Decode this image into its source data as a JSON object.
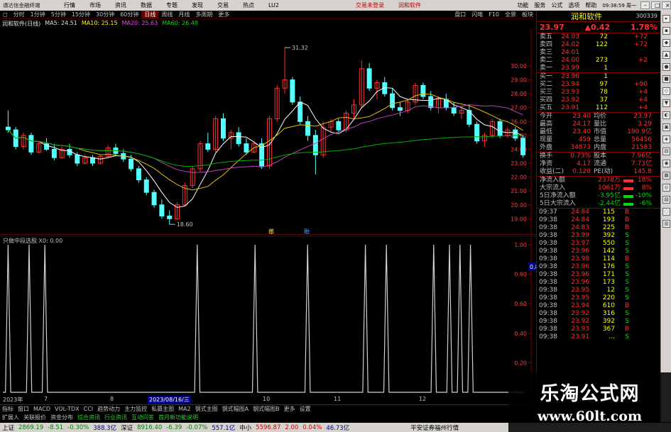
{
  "menubar": {
    "app_title": "通达信金融终端",
    "items": [
      "行情",
      "市场",
      "资讯",
      "数据",
      "专题",
      "发现",
      "交易",
      "热点",
      "LU2"
    ],
    "center_links": [
      "交易未登录",
      "润和软件"
    ],
    "right_items": [
      "功能",
      "服务",
      "公式",
      "选项",
      "帮助"
    ],
    "clock": "09:38:59 周一"
  },
  "period_tabs": {
    "items": [
      "分时",
      "1分钟",
      "5分钟",
      "15分钟",
      "30分钟",
      "60分钟",
      "日线",
      "周线",
      "月线",
      "多周期",
      "更多"
    ],
    "active": "日线"
  },
  "toolbar_right": [
    "盘口",
    "闪电",
    "F10",
    "全景",
    "板块"
  ],
  "ma_line": {
    "stock": "润和软件(日线)",
    "ma5_label": "MA5: 24.51",
    "ma10_label": "MA10: 25.15",
    "ma20_label": "MA20: 25.63",
    "ma60_label": "MA60: 26.48"
  },
  "colors": {
    "up": "#ff3030",
    "down": "#54ffff",
    "ma5": "#ffffff",
    "ma10": "#e0c000",
    "ma20": "#c040c0",
    "ma60": "#00b000",
    "axis": "#800000",
    "signal": "#d0d0d0"
  },
  "chart_data": [
    {
      "type": "candlestick",
      "ylim": [
        18.0,
        32.5
      ],
      "y_ticks": [
        "30.00",
        "29.00",
        "28.00",
        "27.00",
        "26.00",
        "25.00",
        "24.00",
        "23.00",
        "22.00",
        "21.00",
        "20.00",
        "19.00"
      ],
      "annotations": [
        "31.32",
        "18.60"
      ],
      "markers": [
        "撤",
        "融"
      ],
      "ohlc": [
        [
          25.6,
          26.8,
          25.2,
          25.4
        ],
        [
          25.4,
          25.6,
          24.0,
          24.2
        ],
        [
          24.2,
          25.2,
          24.0,
          25.0
        ],
        [
          25.0,
          25.2,
          23.6,
          23.8
        ],
        [
          23.8,
          24.6,
          23.7,
          24.4
        ],
        [
          24.4,
          24.8,
          23.9,
          24.0
        ],
        [
          24.0,
          24.4,
          23.2,
          23.4
        ],
        [
          23.4,
          24.2,
          23.3,
          24.0
        ],
        [
          24.0,
          24.4,
          23.4,
          23.6
        ],
        [
          23.6,
          23.8,
          22.8,
          23.0
        ],
        [
          23.0,
          23.6,
          22.9,
          23.4
        ],
        [
          23.4,
          23.6,
          22.8,
          23.0
        ],
        [
          23.0,
          23.6,
          22.9,
          23.5
        ],
        [
          23.5,
          24.3,
          23.4,
          24.1
        ],
        [
          24.1,
          24.4,
          23.5,
          23.7
        ],
        [
          23.7,
          24.0,
          23.1,
          23.3
        ],
        [
          23.3,
          23.6,
          22.4,
          22.6
        ],
        [
          22.6,
          22.8,
          21.6,
          21.8
        ],
        [
          21.8,
          22.0,
          20.7,
          20.9
        ],
        [
          20.9,
          21.1,
          19.8,
          20.0
        ],
        [
          20.0,
          20.4,
          19.0,
          19.2
        ],
        [
          19.2,
          19.6,
          18.6,
          19.0
        ],
        [
          19.0,
          20.2,
          18.9,
          20.0
        ],
        [
          20.0,
          21.6,
          19.9,
          21.4
        ],
        [
          21.4,
          22.8,
          21.2,
          22.6
        ],
        [
          22.6,
          24.6,
          22.4,
          24.4
        ],
        [
          24.4,
          25.2,
          23.8,
          24.0
        ],
        [
          24.0,
          26.4,
          23.8,
          26.2
        ],
        [
          26.2,
          26.6,
          24.6,
          24.8
        ],
        [
          24.8,
          25.4,
          24.0,
          25.2
        ],
        [
          25.2,
          25.6,
          24.2,
          24.4
        ],
        [
          24.4,
          24.8,
          23.6,
          23.8
        ],
        [
          23.8,
          24.6,
          23.7,
          24.4
        ],
        [
          24.4,
          24.8,
          22.6,
          22.8
        ],
        [
          22.8,
          26.4,
          22.6,
          26.2
        ],
        [
          26.2,
          28.6,
          26.0,
          28.4
        ],
        [
          28.4,
          31.32,
          28.0,
          29.0
        ],
        [
          29.0,
          29.2,
          27.2,
          27.4
        ],
        [
          27.4,
          27.8,
          25.8,
          26.0
        ],
        [
          26.0,
          26.4,
          24.6,
          25.0
        ],
        [
          25.0,
          25.4,
          22.2,
          23.6
        ],
        [
          23.6,
          26.0,
          23.4,
          25.6
        ],
        [
          25.6,
          26.2,
          25.2,
          26.0
        ],
        [
          26.0,
          26.2,
          25.2,
          25.4
        ],
        [
          25.4,
          26.8,
          25.2,
          26.6
        ],
        [
          26.6,
          27.6,
          26.2,
          27.2
        ],
        [
          27.2,
          30.4,
          27.0,
          29.8
        ],
        [
          29.8,
          30.2,
          28.2,
          28.4
        ],
        [
          28.4,
          29.0,
          27.6,
          28.8
        ],
        [
          28.8,
          29.2,
          27.8,
          28.0
        ],
        [
          28.0,
          28.4,
          26.8,
          27.0
        ],
        [
          27.0,
          27.4,
          26.4,
          26.8
        ],
        [
          26.8,
          27.6,
          26.6,
          27.4
        ],
        [
          27.4,
          28.8,
          27.2,
          28.6
        ],
        [
          28.6,
          28.8,
          27.6,
          27.8
        ],
        [
          27.8,
          28.2,
          26.8,
          27.0
        ],
        [
          27.0,
          27.8,
          26.6,
          27.6
        ],
        [
          27.6,
          28.0,
          26.8,
          27.0
        ],
        [
          27.0,
          27.4,
          26.4,
          26.6
        ],
        [
          26.6,
          27.0,
          26.2,
          26.8
        ],
        [
          26.8,
          27.2,
          25.6,
          25.8
        ],
        [
          25.8,
          26.0,
          24.4,
          24.6
        ],
        [
          24.6,
          25.2,
          24.2,
          25.0
        ],
        [
          25.0,
          26.2,
          24.8,
          26.0
        ],
        [
          26.0,
          26.2,
          24.8,
          25.0
        ],
        [
          25.0,
          25.6,
          24.8,
          25.4
        ],
        [
          25.4,
          25.6,
          24.6,
          24.8
        ],
        [
          24.8,
          25.0,
          23.4,
          23.6
        ]
      ]
    },
    {
      "type": "line",
      "title": "只做中段选股 X0: 0.00",
      "y_ticks": [
        "1.00",
        "0.80",
        "0.60",
        "0.40",
        "0.20",
        "0.00"
      ],
      "cursor_value": "0.85",
      "spike_positions": [
        1,
        5,
        8,
        37,
        48,
        58,
        69,
        73,
        82,
        85,
        87,
        89
      ]
    }
  ],
  "date_axis": {
    "labels": [
      "2023年",
      "7",
      "8",
      "2023/08/16/三",
      "10",
      "11",
      "12"
    ],
    "highlight": "2023/08/16/三"
  },
  "bottom_tabs_1": [
    "指标",
    "窗口",
    "MACD",
    "VOL-TDX",
    "CCI",
    "趋势动力",
    "主力监控",
    "私募主图",
    "MA2",
    "钢式主图",
    "钢式幅图A",
    "钢式幅图B",
    "更多",
    "设置"
  ],
  "bottom_tabs_2": [
    "扩展人",
    "关联报价",
    "资金分布",
    "综合资讯",
    "行业资讯",
    "互动问答",
    "首月新功能说明"
  ],
  "status": {
    "sh_label": "上证",
    "sh_val": "2869.19",
    "sh_chg": "-8.51",
    "sh_pct": "-0.30%",
    "sh_amt": "388.3亿",
    "sz_label": "深证",
    "sz_val": "8916.40",
    "sz_chg": "-6.39",
    "sz_pct": "-0.07%",
    "sz_amt": "557.1亿",
    "zx_label": "中小",
    "zx_val": "5596.87",
    "zx_chg": "2.00",
    "zx_pct": "0.04%",
    "zx_amt": "46.73亿",
    "broker": "平安证券福州行情"
  },
  "quote": {
    "name": "润和软件",
    "code": "300339",
    "price": "23.97",
    "change": "▲0.42",
    "pct": "1.78%",
    "sells": [
      {
        "label": "卖五",
        "price": "24.03",
        "vol": "72",
        "chg": "+72"
      },
      {
        "label": "卖四",
        "price": "24.02",
        "vol": "122",
        "chg": "+72"
      },
      {
        "label": "卖三",
        "price": "24.01",
        "vol": "",
        "chg": ""
      },
      {
        "label": "卖二",
        "price": "24.00",
        "vol": "273",
        "chg": "+2"
      },
      {
        "label": "卖一",
        "price": "23.99",
        "vol": "1",
        "chg": ""
      }
    ],
    "buys": [
      {
        "label": "买一",
        "price": "23.96",
        "vol": "1",
        "chg": ""
      },
      {
        "label": "买二",
        "price": "23.94",
        "vol": "97",
        "chg": "+90"
      },
      {
        "label": "买三",
        "price": "23.93",
        "vol": "78",
        "chg": "+4"
      },
      {
        "label": "买四",
        "price": "23.92",
        "vol": "37",
        "chg": "+4"
      },
      {
        "label": "买五",
        "price": "23.91",
        "vol": "112",
        "chg": "+4"
      }
    ],
    "stats": [
      {
        "k1": "今开",
        "v1": "23.40",
        "k2": "均价",
        "v2": "23.97"
      },
      {
        "k1": "最高",
        "v1": "24.17",
        "k2": "量比",
        "v2": "3.29"
      },
      {
        "k1": "最低",
        "v1": "23.40",
        "k2": "市值",
        "v2": "190.9亿"
      },
      {
        "k1": "现量",
        "v1": "459",
        "k2": "总量",
        "v2": "56456"
      },
      {
        "k1": "外盘",
        "v1": "34873",
        "k2": "内盘",
        "v2": "21583"
      }
    ],
    "stats2": [
      {
        "k1": "换手",
        "v1": "0.73%",
        "k2": "股本",
        "v2": "7.96亿"
      },
      {
        "k1": "净资",
        "v1": "4.17",
        "k2": "流通",
        "v2": "7.73亿"
      },
      {
        "k1": "收益(二)",
        "v1": "0.120",
        "k2": "PE(动)",
        "v2": "145.8"
      }
    ],
    "flows": [
      {
        "k": "净流入额",
        "v": "2378万",
        "p": "18%",
        "c": "red"
      },
      {
        "k": "大宗流入",
        "v": "1061万",
        "p": "8%",
        "c": "red"
      },
      {
        "k": "5日净流入额",
        "v": "-3.95亿",
        "p": "-10%",
        "c": "grn"
      },
      {
        "k": "5日大宗流入",
        "v": "-2.44亿",
        "p": "-6%",
        "c": "grn"
      }
    ],
    "ticks": [
      {
        "t": "09:37",
        "p": "24.84",
        "v": "115",
        "s": "B"
      },
      {
        "t": "09:38",
        "p": "24.84",
        "v": "193",
        "s": "B"
      },
      {
        "t": "09:38",
        "p": "24.83",
        "v": "225",
        "s": "B"
      },
      {
        "t": "09:38",
        "p": "23.99",
        "v": "392",
        "s": "S"
      },
      {
        "t": "09:38",
        "p": "23.97",
        "v": "550",
        "s": "S"
      },
      {
        "t": "09:38",
        "p": "23.96",
        "v": "142",
        "s": "S"
      },
      {
        "t": "09:38",
        "p": "23.98",
        "v": "114",
        "s": "B"
      },
      {
        "t": "09:38",
        "p": "23.96",
        "v": "176",
        "s": "S"
      },
      {
        "t": "09:38",
        "p": "23.96",
        "v": "171",
        "s": "S"
      },
      {
        "t": "09:38",
        "p": "23.96",
        "v": "173",
        "s": "S"
      },
      {
        "t": "09:38",
        "p": "23.95",
        "v": "12",
        "s": "S"
      },
      {
        "t": "09:38",
        "p": "23.95",
        "v": "220",
        "s": "S"
      },
      {
        "t": "09:38",
        "p": "23.94",
        "v": "610",
        "s": "B"
      },
      {
        "t": "09:38",
        "p": "23.92",
        "v": "316",
        "s": "S"
      },
      {
        "t": "09:38",
        "p": "23.92",
        "v": "392",
        "s": "S"
      },
      {
        "t": "09:38",
        "p": "23.93",
        "v": "367",
        "s": "B"
      },
      {
        "t": "09:38",
        "p": "23.91",
        "v": "...",
        "s": "S"
      }
    ]
  },
  "watermark": {
    "line1": "乐淘公式网",
    "line2": "www.60lt.com"
  }
}
